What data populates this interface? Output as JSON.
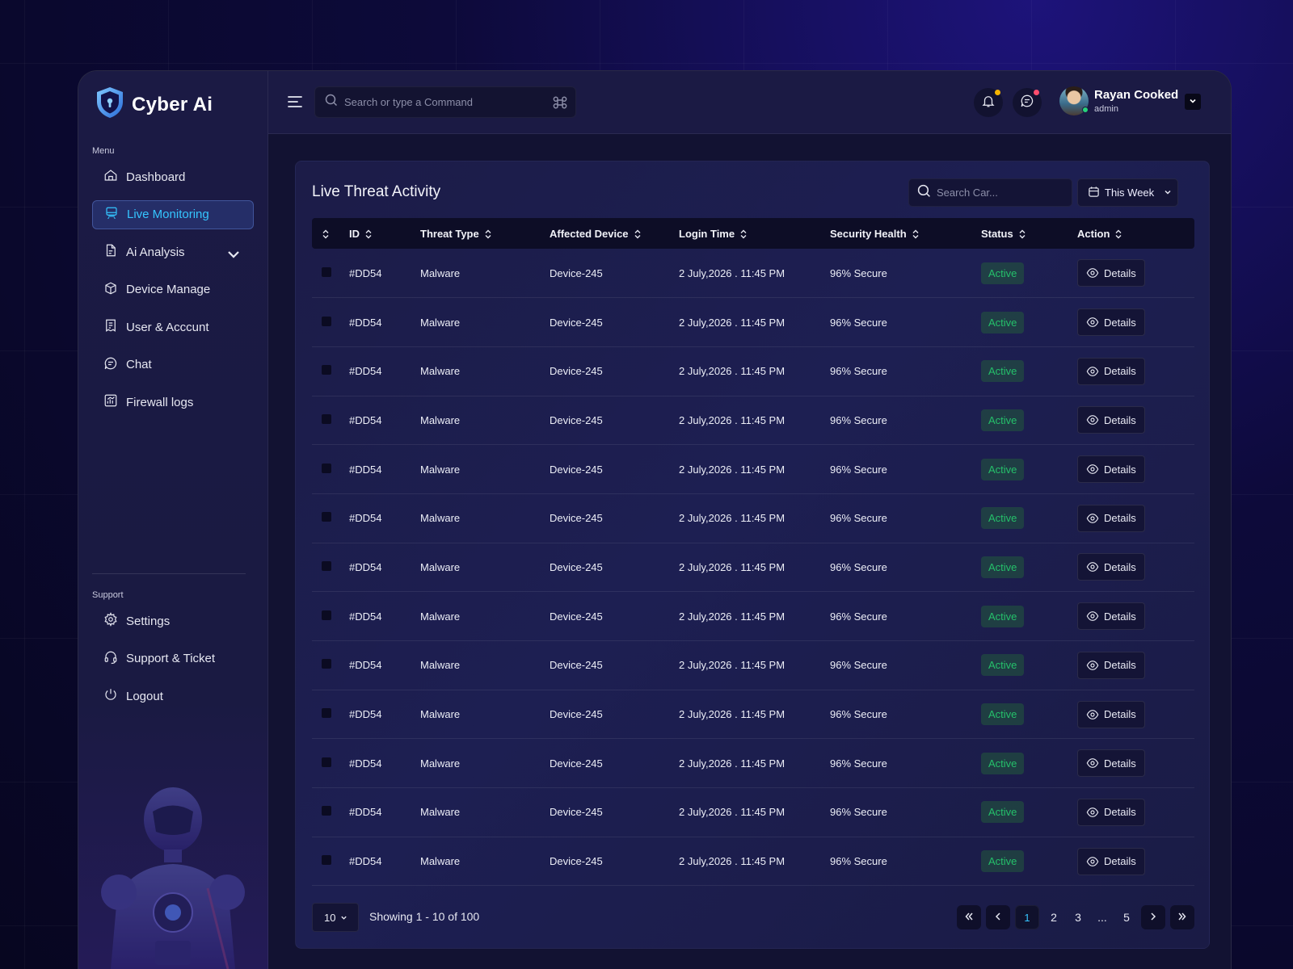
{
  "brand": {
    "name": "Cyber Ai"
  },
  "sidebar": {
    "menu_label": "Menu",
    "items": [
      {
        "label": "Dashboard",
        "icon": "home-icon"
      },
      {
        "label": "Live Monitoring",
        "icon": "monitor-icon",
        "active": true
      },
      {
        "label": "Ai Analysis",
        "icon": "document-icon",
        "has_dropdown": true
      },
      {
        "label": "Device Manage",
        "icon": "box-icon"
      },
      {
        "label": "User & Acccunt",
        "icon": "receipt-icon"
      },
      {
        "label": "Chat",
        "icon": "chat-icon"
      },
      {
        "label": "Firewall logs",
        "icon": "chart-icon"
      }
    ],
    "support_label": "Support",
    "support_items": [
      {
        "label": "Settings",
        "icon": "gear-icon"
      },
      {
        "label": "Support & Ticket",
        "icon": "headset-icon"
      },
      {
        "label": "Logout",
        "icon": "power-icon"
      }
    ]
  },
  "topbar": {
    "search_placeholder": "Search or type a Command",
    "notification_dot_color": "#f5b400",
    "message_dot_color": "#ff4d6d",
    "user": {
      "name": "Rayan Cooked",
      "role": "admin"
    }
  },
  "card": {
    "title": "Live Threat Activity",
    "search_placeholder": "Search Car...",
    "period": "This Week",
    "columns": [
      "ID",
      "Threat Type",
      "Affected Device",
      "Login Time",
      "Security Health",
      "Status",
      "Action"
    ],
    "rows": [
      {
        "id": "#DD54",
        "threat": "Malware",
        "device": "Device-245",
        "time": "2 July,2026 . 11:45 PM",
        "health": "96% Secure",
        "status": "Active",
        "action": "Details"
      },
      {
        "id": "#DD54",
        "threat": "Malware",
        "device": "Device-245",
        "time": "2 July,2026 . 11:45 PM",
        "health": "96% Secure",
        "status": "Active",
        "action": "Details"
      },
      {
        "id": "#DD54",
        "threat": "Malware",
        "device": "Device-245",
        "time": "2 July,2026 . 11:45 PM",
        "health": "96% Secure",
        "status": "Active",
        "action": "Details"
      },
      {
        "id": "#DD54",
        "threat": "Malware",
        "device": "Device-245",
        "time": "2 July,2026 . 11:45 PM",
        "health": "96% Secure",
        "status": "Active",
        "action": "Details"
      },
      {
        "id": "#DD54",
        "threat": "Malware",
        "device": "Device-245",
        "time": "2 July,2026 . 11:45 PM",
        "health": "96% Secure",
        "status": "Active",
        "action": "Details"
      },
      {
        "id": "#DD54",
        "threat": "Malware",
        "device": "Device-245",
        "time": "2 July,2026 . 11:45 PM",
        "health": "96% Secure",
        "status": "Active",
        "action": "Details"
      },
      {
        "id": "#DD54",
        "threat": "Malware",
        "device": "Device-245",
        "time": "2 July,2026 . 11:45 PM",
        "health": "96% Secure",
        "status": "Active",
        "action": "Details"
      },
      {
        "id": "#DD54",
        "threat": "Malware",
        "device": "Device-245",
        "time": "2 July,2026 . 11:45 PM",
        "health": "96% Secure",
        "status": "Active",
        "action": "Details"
      },
      {
        "id": "#DD54",
        "threat": "Malware",
        "device": "Device-245",
        "time": "2 July,2026 . 11:45 PM",
        "health": "96% Secure",
        "status": "Active",
        "action": "Details"
      },
      {
        "id": "#DD54",
        "threat": "Malware",
        "device": "Device-245",
        "time": "2 July,2026 . 11:45 PM",
        "health": "96% Secure",
        "status": "Active",
        "action": "Details"
      },
      {
        "id": "#DD54",
        "threat": "Malware",
        "device": "Device-245",
        "time": "2 July,2026 . 11:45 PM",
        "health": "96% Secure",
        "status": "Active",
        "action": "Details"
      },
      {
        "id": "#DD54",
        "threat": "Malware",
        "device": "Device-245",
        "time": "2 July,2026 . 11:45 PM",
        "health": "96% Secure",
        "status": "Active",
        "action": "Details"
      },
      {
        "id": "#DD54",
        "threat": "Malware",
        "device": "Device-245",
        "time": "2 July,2026 . 11:45 PM",
        "health": "96% Secure",
        "status": "Active",
        "action": "Details"
      }
    ]
  },
  "pagination": {
    "page_size": "10",
    "showing": "Showing 1 - 10 of 100",
    "pages": [
      "1",
      "2",
      "3",
      "...",
      "5"
    ],
    "current": "1"
  },
  "colors": {
    "accent": "#35c5ff",
    "status_active": "#25c06a"
  }
}
